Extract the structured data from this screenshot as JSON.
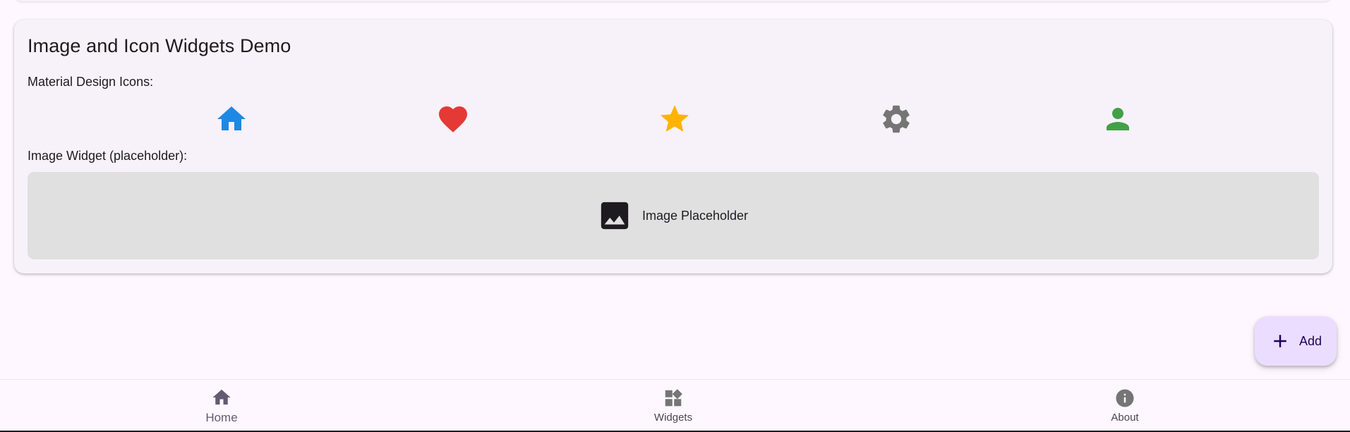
{
  "card": {
    "title": "Image and Icon Widgets Demo",
    "icons_label": "Material Design Icons:",
    "icons": [
      {
        "name": "home-icon",
        "color": "#1e88e5"
      },
      {
        "name": "heart-icon",
        "color": "#e53935"
      },
      {
        "name": "star-icon",
        "color": "#ffb300"
      },
      {
        "name": "gear-icon",
        "color": "#757575"
      },
      {
        "name": "person-icon",
        "color": "#43a047"
      }
    ],
    "image_label": "Image Widget (placeholder):",
    "placeholder": {
      "icon": "image-icon",
      "text": "Image Placeholder"
    }
  },
  "fab": {
    "icon": "plus-icon",
    "label": "Add"
  },
  "bottom_nav": {
    "items": [
      {
        "label": "Home",
        "icon": "home-icon",
        "active": true
      },
      {
        "label": "Widgets",
        "icon": "widgets-icon",
        "active": false
      },
      {
        "label": "About",
        "icon": "info-icon",
        "active": false
      }
    ]
  },
  "colors": {
    "background": "#fef7ff",
    "card": "#f7f2fa",
    "placeholder_bg": "#e0e0e0",
    "fab_bg": "#eaddff",
    "nav_active": "#625b71",
    "nav_inactive": "#757575"
  }
}
